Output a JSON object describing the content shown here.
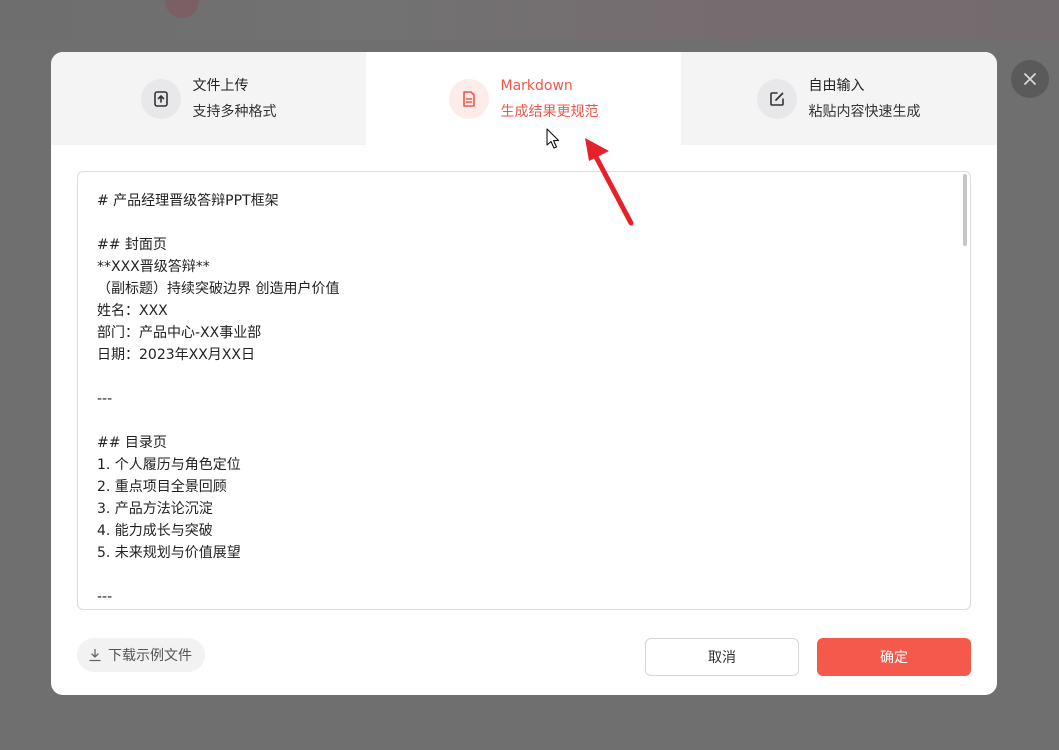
{
  "tabs": [
    {
      "title": "文件上传",
      "subtitle": "支持多种格式",
      "icon": "upload-icon",
      "active": false
    },
    {
      "title": "Markdown",
      "subtitle": "生成结果更规范",
      "icon": "document-icon",
      "active": true
    },
    {
      "title": "自由输入",
      "subtitle": "粘贴内容快速生成",
      "icon": "edit-icon",
      "active": false
    }
  ],
  "editor": {
    "lines": [
      "# 产品经理晋级答辩PPT框架",
      "",
      "## 封面页",
      "**XXX晋级答辩**",
      "（副标题）持续突破边界 创造用户价值",
      "姓名：XXX",
      "部门：产品中心-XX事业部",
      "日期：2023年XX月XX日",
      "",
      "---",
      "",
      "## 目录页",
      "1. 个人履历与角色定位",
      "2. 重点项目全景回顾",
      "3. 产品方法论沉淀",
      "4. 能力成长与突破",
      "5. 未来规划与价值展望",
      "",
      "---"
    ]
  },
  "footer": {
    "download_label": "下载示例文件",
    "cancel_label": "取消",
    "confirm_label": "确定"
  },
  "colors": {
    "accent": "#f5594c",
    "active_text": "#f0564a",
    "tab_bar_bg": "#f4f4f5",
    "overlay": "#6f6f6f",
    "annotation_arrow": "#e8202a"
  }
}
